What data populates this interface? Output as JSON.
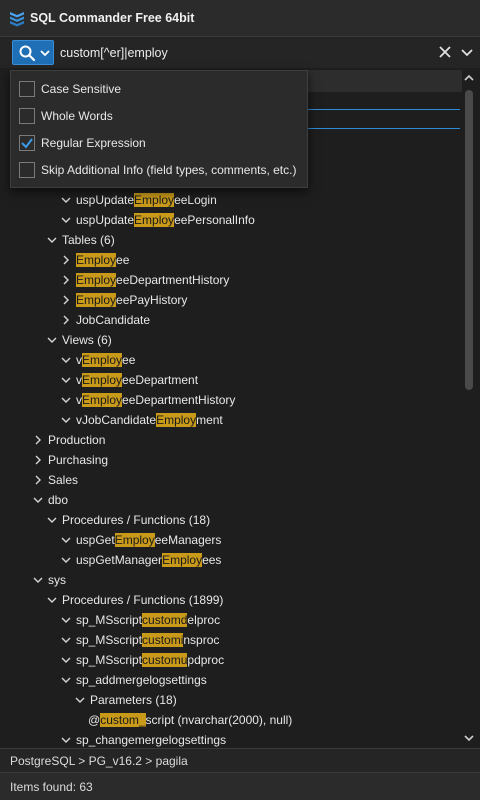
{
  "window": {
    "title": "SQL Commander Free 64bit"
  },
  "search": {
    "query": "custom[^er]|employ"
  },
  "options": [
    {
      "label": "Case Sensitive",
      "checked": false
    },
    {
      "label": "Whole Words",
      "checked": false
    },
    {
      "label": "Regular Expression",
      "checked": true
    },
    {
      "label": "Skip Additional Info (field types, comments, etc.)",
      "checked": false
    }
  ],
  "tree": [
    {
      "level": 5,
      "chev": "down",
      "parts": [
        "uspUpdate",
        {
          "h": "Employ"
        },
        "eeLogin"
      ]
    },
    {
      "level": 5,
      "chev": "down",
      "parts": [
        "uspUpdate",
        {
          "h": "Employ"
        },
        "eePersonalInfo"
      ]
    },
    {
      "level": 4,
      "chev": "down",
      "parts": [
        "Tables (6)"
      ]
    },
    {
      "level": 5,
      "chev": "right",
      "parts": [
        {
          "h": "Employ"
        },
        "ee"
      ]
    },
    {
      "level": 5,
      "chev": "right",
      "parts": [
        {
          "h": "Employ"
        },
        "eeDepartmentHistory"
      ]
    },
    {
      "level": 5,
      "chev": "right",
      "parts": [
        {
          "h": "Employ"
        },
        "eePayHistory"
      ]
    },
    {
      "level": 5,
      "chev": "right",
      "parts": [
        "JobCandidate"
      ]
    },
    {
      "level": 4,
      "chev": "down",
      "parts": [
        "Views (6)"
      ]
    },
    {
      "level": 5,
      "chev": "down",
      "parts": [
        "v",
        {
          "h": "Employ"
        },
        "ee"
      ]
    },
    {
      "level": 5,
      "chev": "down",
      "parts": [
        "v",
        {
          "h": "Employ"
        },
        "eeDepartment"
      ]
    },
    {
      "level": 5,
      "chev": "down",
      "parts": [
        "v",
        {
          "h": "Employ"
        },
        "eeDepartmentHistory"
      ]
    },
    {
      "level": 5,
      "chev": "down",
      "parts": [
        "vJobCandidate",
        {
          "h": "Employ"
        },
        "ment"
      ]
    },
    {
      "level": 3,
      "chev": "right",
      "parts": [
        "Production"
      ]
    },
    {
      "level": 3,
      "chev": "right",
      "parts": [
        "Purchasing"
      ]
    },
    {
      "level": 3,
      "chev": "right",
      "parts": [
        "Sales"
      ]
    },
    {
      "level": 3,
      "chev": "down",
      "parts": [
        "dbo"
      ]
    },
    {
      "level": 4,
      "chev": "down",
      "parts": [
        "Procedures / Functions (18)"
      ]
    },
    {
      "level": 5,
      "chev": "down",
      "parts": [
        "uspGet",
        {
          "h": "Employ"
        },
        "eeManagers"
      ]
    },
    {
      "level": 5,
      "chev": "down",
      "parts": [
        "uspGetManager",
        {
          "h": "Employ"
        },
        "ees"
      ]
    },
    {
      "level": 3,
      "chev": "down",
      "parts": [
        "sys"
      ]
    },
    {
      "level": 4,
      "chev": "down",
      "parts": [
        "Procedures / Functions (1899)"
      ]
    },
    {
      "level": 5,
      "chev": "down",
      "parts": [
        "sp_MSscript",
        {
          "h": "customd"
        },
        "elproc"
      ]
    },
    {
      "level": 5,
      "chev": "down",
      "parts": [
        "sp_MSscript",
        {
          "h": "customi"
        },
        "nsproc"
      ]
    },
    {
      "level": 5,
      "chev": "down",
      "parts": [
        "sp_MSscript",
        {
          "h": "customu"
        },
        "pdproc"
      ]
    },
    {
      "level": 5,
      "chev": "down",
      "parts": [
        "sp_addmergelogsettings"
      ]
    },
    {
      "level": 6,
      "chev": "down",
      "parts": [
        "Parameters (18)"
      ]
    },
    {
      "level": 7,
      "chev": "none",
      "parts": [
        "@",
        {
          "h": "custom_"
        },
        "script (nvarchar(2000), null)"
      ]
    },
    {
      "level": 5,
      "chev": "down",
      "parts": [
        "sp_changemergelogsettings"
      ]
    }
  ],
  "status": {
    "path": "PostgreSQL > PG_v16.2 > pagila",
    "found": "Items found: 63"
  },
  "colors": {
    "accent": "#1f6fb6",
    "highlight": "#c99a1a",
    "background": "#1e1e1e"
  }
}
